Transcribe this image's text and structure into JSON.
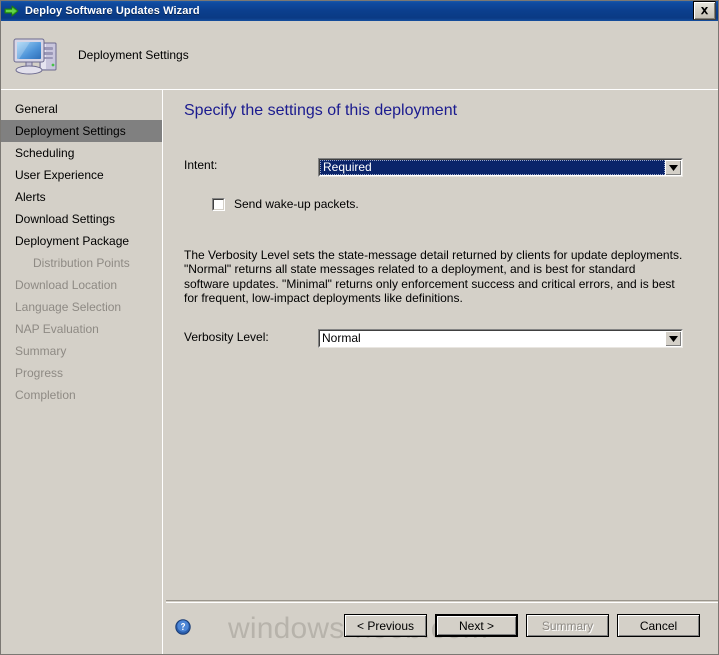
{
  "window": {
    "title": "Deploy Software Updates Wizard",
    "title_icon": "green-arrow-icon",
    "close_label": "Close"
  },
  "banner": {
    "icon": "computer-icon",
    "title": "Deployment Settings"
  },
  "sidebar": {
    "items": [
      {
        "label": "General",
        "state": "normal",
        "indent": false
      },
      {
        "label": "Deployment Settings",
        "state": "active",
        "indent": false
      },
      {
        "label": "Scheduling",
        "state": "normal",
        "indent": false
      },
      {
        "label": "User Experience",
        "state": "normal",
        "indent": false
      },
      {
        "label": "Alerts",
        "state": "normal",
        "indent": false
      },
      {
        "label": "Download Settings",
        "state": "normal",
        "indent": false
      },
      {
        "label": "Deployment Package",
        "state": "normal",
        "indent": false
      },
      {
        "label": "Distribution Points",
        "state": "disabled",
        "indent": true
      },
      {
        "label": "Download Location",
        "state": "disabled",
        "indent": false
      },
      {
        "label": "Language Selection",
        "state": "disabled",
        "indent": false
      },
      {
        "label": "NAP Evaluation",
        "state": "disabled",
        "indent": false
      },
      {
        "label": "Summary",
        "state": "disabled",
        "indent": false
      },
      {
        "label": "Progress",
        "state": "disabled",
        "indent": false
      },
      {
        "label": "Completion",
        "state": "disabled",
        "indent": false
      }
    ]
  },
  "content": {
    "heading": "Specify the settings of this deployment",
    "intent": {
      "label": "Intent:",
      "value": "Required"
    },
    "wake_up": {
      "label": "Send wake-up packets.",
      "checked": false
    },
    "description": "The Verbosity Level sets the state-message detail returned by clients for update deployments.  \"Normal\" returns all state messages related to a deployment, and is best for standard software updates.  \"Minimal\" returns only enforcement success and critical errors, and is best for frequent, low-impact deployments like definitions.",
    "verbosity": {
      "label": "Verbosity Level:",
      "value": "Normal"
    }
  },
  "footer": {
    "help_icon": "help-question-icon",
    "watermark": "windows-noob.com",
    "buttons": {
      "previous": "< Previous",
      "next": "Next >",
      "summary": "Summary",
      "cancel": "Cancel"
    }
  },
  "colors": {
    "titlebar": "#0b3f8e",
    "face": "#d4d0c8",
    "heading": "#1b1b8f",
    "selection": "#0a246a",
    "active_item": "#808080",
    "disabled_text": "#8e8a84",
    "watermark": "#b7b3ab"
  }
}
